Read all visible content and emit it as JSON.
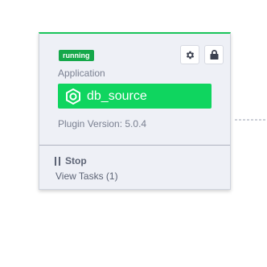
{
  "node": {
    "status_badge": "running",
    "type_label": "Application",
    "name": "db_source",
    "version_text": "Plugin Version: 5.0.4",
    "stop_label": "Stop",
    "tasks_label": "View Tasks (1)"
  },
  "colors": {
    "accent": "#0fd55f",
    "badge": "#15a84a",
    "card_bg": "#eef0f6",
    "connector": "#aeb3bf"
  },
  "icons": [
    "settings-icon",
    "lock-icon",
    "plugin-hexagon-icon",
    "pause-icon",
    "arrow-right-icon"
  ]
}
